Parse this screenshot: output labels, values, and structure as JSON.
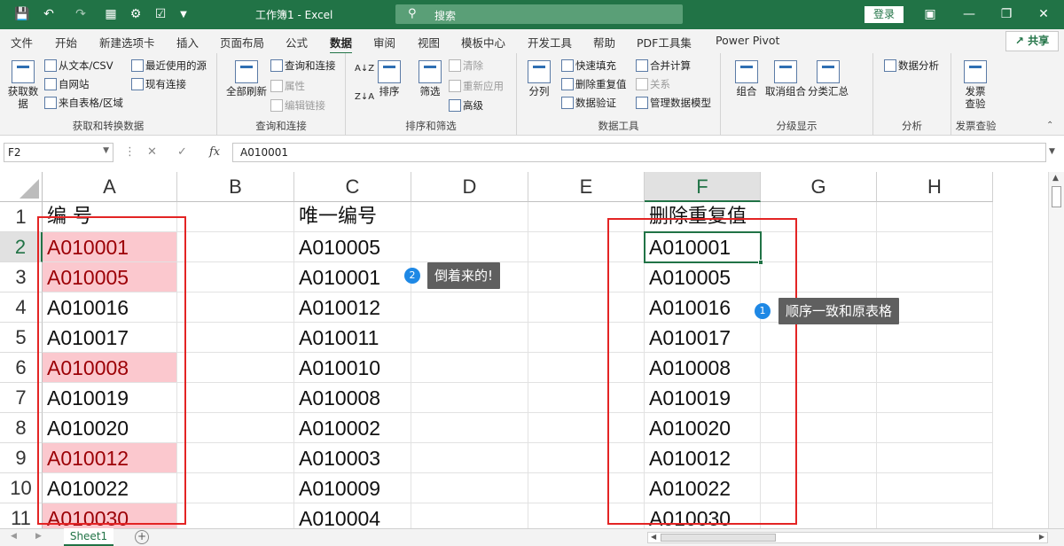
{
  "window": {
    "title": "工作簿1  -  Excel",
    "search_placeholder": "搜索",
    "login_label": "登录",
    "quick_access": [
      "save-icon",
      "undo-icon",
      "redo-icon",
      "form-icon",
      "settings-icon",
      "checkbox-icon",
      "customize-icon"
    ]
  },
  "menu": {
    "tabs": [
      "文件",
      "开始",
      "新建选项卡",
      "插入",
      "页面布局",
      "公式",
      "数据",
      "审阅",
      "视图",
      "模板中心",
      "开发工具",
      "帮助",
      "PDF工具集",
      "Power Pivot"
    ],
    "active_tab": "数据",
    "share_label": "共享"
  },
  "ribbon": {
    "get_data": {
      "label": "获取和转换数据",
      "big_button": "获取数据",
      "from_text": "从文本/CSV",
      "from_web": "自网站",
      "from_table": "来自表格/区域",
      "recent_sources": "最近使用的源",
      "existing_connections": "现有连接"
    },
    "queries": {
      "label": "查询和连接",
      "refresh_all": "全部刷新",
      "queries_connections": "查询和连接",
      "properties": "属性",
      "edit_links": "编辑链接"
    },
    "sort_filter": {
      "label": "排序和筛选",
      "sort": "排序",
      "filter": "筛选",
      "clear": "清除",
      "reapply": "重新应用",
      "advanced": "高级"
    },
    "data_tools": {
      "label": "数据工具",
      "text_to_columns": "分列",
      "flash_fill": "快速填充",
      "remove_duplicates": "删除重复值",
      "data_validation": "数据验证",
      "consolidate": "合并计算",
      "relationships": "关系",
      "manage_model": "管理数据模型"
    },
    "outline": {
      "label": "分级显示",
      "group": "组合",
      "ungroup": "取消组合",
      "subtotal": "分类汇总"
    },
    "analysis": {
      "label": "分析",
      "data_analysis": "数据分析"
    },
    "invoice": {
      "label": "发票查验",
      "button": "发票查验"
    }
  },
  "formula_bar": {
    "name_box": "F2",
    "content": "A010001",
    "fx": "fx"
  },
  "columns": [
    "A",
    "B",
    "C",
    "D",
    "E",
    "F",
    "G",
    "H"
  ],
  "selected_column": "F",
  "rows": [
    "1",
    "2",
    "3",
    "4",
    "5",
    "6",
    "7",
    "8",
    "9",
    "10",
    "11"
  ],
  "selected_row": "2",
  "cells": {
    "A": [
      "编  号",
      "A010001",
      "A010005",
      "A010016",
      "A010017",
      "A010008",
      "A010019",
      "A010020",
      "A010012",
      "A010022",
      "A010030"
    ],
    "C": [
      "唯一编号",
      "A010005",
      "A010001",
      "A010012",
      "A010011",
      "A010010",
      "A010008",
      "A010002",
      "A010003",
      "A010009",
      "A010004"
    ],
    "F": [
      "删除重复值",
      "A010001",
      "A010005",
      "A010016",
      "A010017",
      "A010008",
      "A010019",
      "A010020",
      "A010012",
      "A010022",
      "A010030"
    ]
  },
  "duplicate_highlight_rows_A": [
    2,
    3,
    6,
    9,
    11
  ],
  "highlight_colors": {
    "fill": "#fbc8ce",
    "text": "#9c0006",
    "box": "#e32424",
    "accent": "#217346"
  },
  "annotations": [
    {
      "num": "2",
      "text": "倒着来的!"
    },
    {
      "num": "1",
      "text": "顺序一致和原表格"
    }
  ],
  "sheet_tabs": [
    "Sheet1"
  ]
}
